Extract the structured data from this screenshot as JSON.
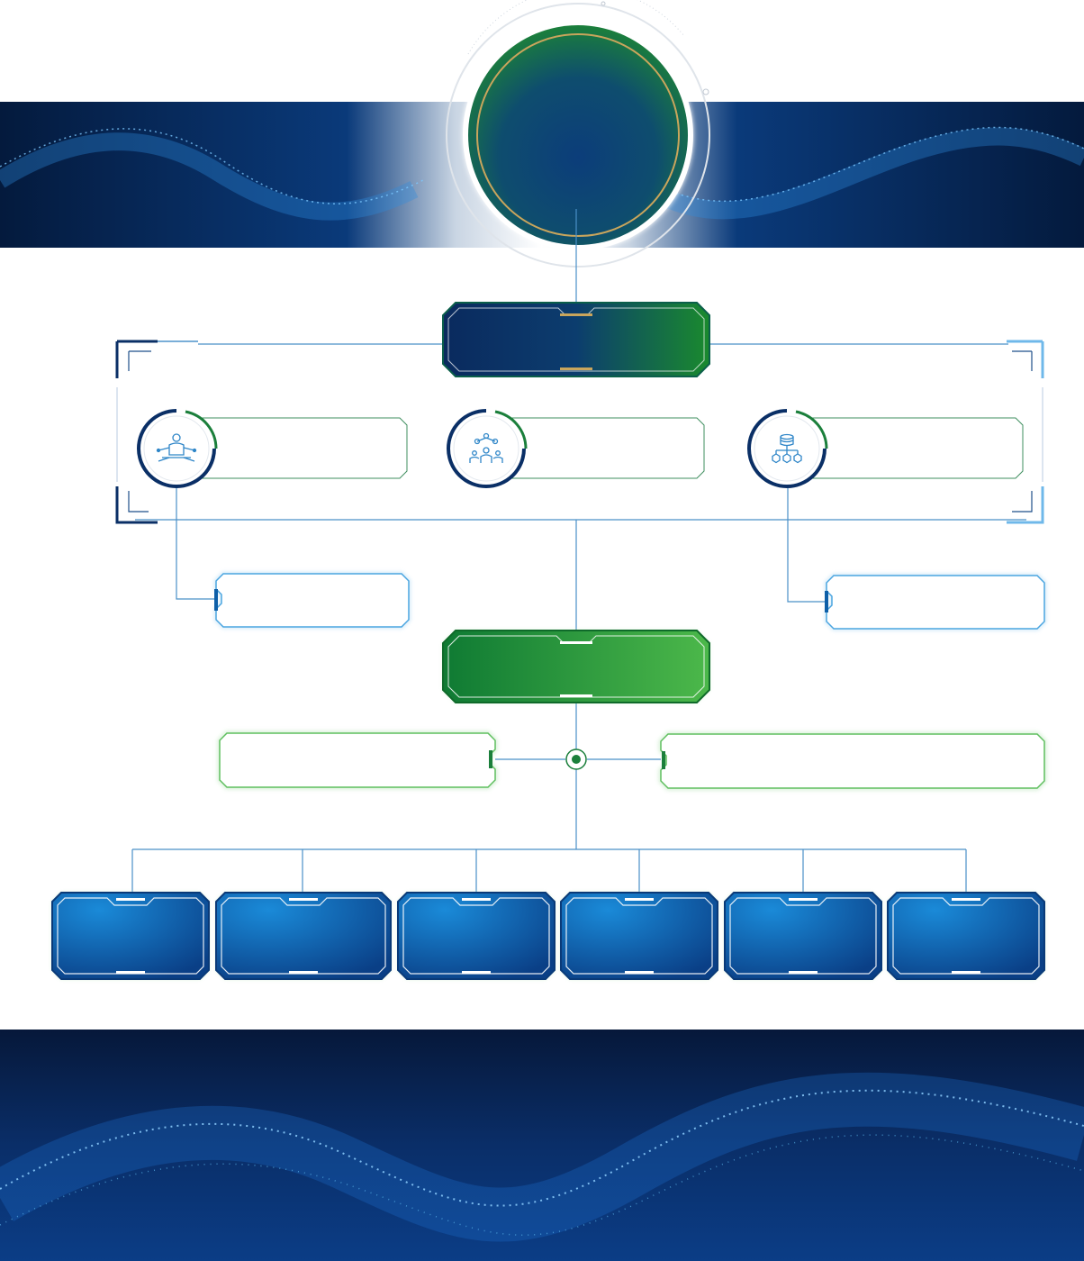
{
  "diagram": {
    "top_circle_label": "",
    "level1_box_label": "",
    "branches": [
      {
        "icon": "meditation-person-icon",
        "label": "",
        "sub_label": ""
      },
      {
        "icon": "team-network-icon",
        "label": ""
      },
      {
        "icon": "database-hierarchy-icon",
        "label": "",
        "sub_label": ""
      }
    ],
    "level2_box_label": "",
    "side_boxes": [
      {
        "label": ""
      },
      {
        "label": ""
      }
    ],
    "bottom_boxes": [
      {
        "label": ""
      },
      {
        "label": ""
      },
      {
        "label": ""
      },
      {
        "label": ""
      },
      {
        "label": ""
      },
      {
        "label": ""
      }
    ]
  },
  "colors": {
    "navy": "#0a2f66",
    "blue": "#0d5fa8",
    "light_blue": "#5ab4e8",
    "green": "#1b7f3b",
    "light_green": "#7fcf7f",
    "gold": "#c9a55c",
    "connector": "#4a90c8"
  }
}
